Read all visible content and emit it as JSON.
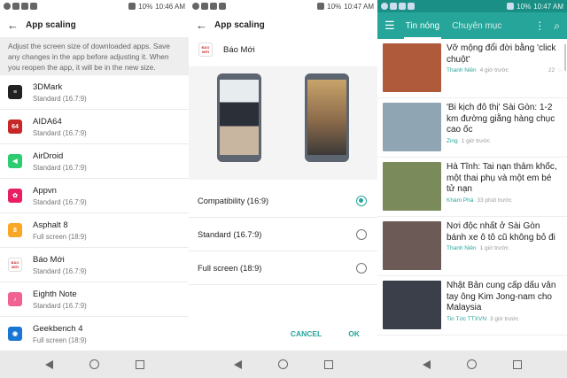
{
  "panel1": {
    "status": {
      "battery": "10%",
      "time": "10:46 AM"
    },
    "title": "App scaling",
    "description": "Adjust the screen size of downloaded apps. Save any changes in the app before adjusting it. When you reopen the app, it will be in the new size.",
    "apps": [
      {
        "name": "3DMark",
        "mode": "Standard (16.7:9)",
        "color": "#222222",
        "glyph": "≡"
      },
      {
        "name": "AIDA64",
        "mode": "Standard (16.7:9)",
        "color": "#c62828",
        "glyph": "64"
      },
      {
        "name": "AirDroid",
        "mode": "Standard (16.7:9)",
        "color": "#2ecc71",
        "glyph": "◀"
      },
      {
        "name": "Appvn",
        "mode": "Standard (16.7:9)",
        "color": "#e91e63",
        "glyph": "✿"
      },
      {
        "name": "Asphalt 8",
        "mode": "Full screen (18:9)",
        "color": "#f9a825",
        "glyph": "8"
      },
      {
        "name": "Báo Mới",
        "mode": "Standard (16.7:9)",
        "color": "#ffffff",
        "glyph": "BÁO MỚI"
      },
      {
        "name": "Eighth Note",
        "mode": "Standard (16.7:9)",
        "color": "#f06292",
        "glyph": "♪"
      },
      {
        "name": "Geekbench 4",
        "mode": "Full screen (18:9)",
        "color": "#1976d2",
        "glyph": "◉"
      }
    ]
  },
  "panel2": {
    "status": {
      "battery": "10%",
      "time": "10:47 AM"
    },
    "title": "App scaling",
    "selected_app": "Báo Mới",
    "app_icon_text": "BÁO MỚI",
    "options": [
      {
        "label": "Compatibility (16:9)",
        "selected": true
      },
      {
        "label": "Standard (16.7:9)",
        "selected": false
      },
      {
        "label": "Full screen (18:9)",
        "selected": false
      }
    ],
    "cancel_label": "CANCEL",
    "ok_label": "OK"
  },
  "panel3": {
    "status": {
      "battery": "10%",
      "time": "10:47 AM"
    },
    "tabs": [
      "Tin nóng",
      "Chuyên mục"
    ],
    "accent": "#26a69a",
    "news": [
      {
        "title": "Vỡ mộng đổi đời bằng 'click chuột'",
        "source": "Thanh Niên",
        "time": "4 giờ trước",
        "comments": "22",
        "thumb": "#b05a3c"
      },
      {
        "title": "'Bi kịch đô thị' Sài Gòn: 1-2 km đường giằng hàng chục cao ốc",
        "source": "Zing",
        "time": "1 giờ trước",
        "comments": "",
        "thumb": "#8fa5b4"
      },
      {
        "title": "Hà Tĩnh: Tai nạn thảm khốc, một thai phụ và một em bé tử nạn",
        "source": "Khám Phá",
        "time": "33 phút trước",
        "comments": "",
        "thumb": "#7a8a5a"
      },
      {
        "title": "Nơi độc nhất ở Sài Gòn bánh xe ô tô cũ không bỏ đi",
        "source": "Thanh Niên",
        "time": "1 giờ trước",
        "comments": "",
        "thumb": "#6b5a55"
      },
      {
        "title": "Nhật Bản cung cấp dấu vân tay ông Kim Jong-nam cho Malaysia",
        "source": "Tin Tức TTXVN",
        "time": "3 giờ trước",
        "comments": "",
        "thumb": "#3a3f4a"
      }
    ]
  }
}
